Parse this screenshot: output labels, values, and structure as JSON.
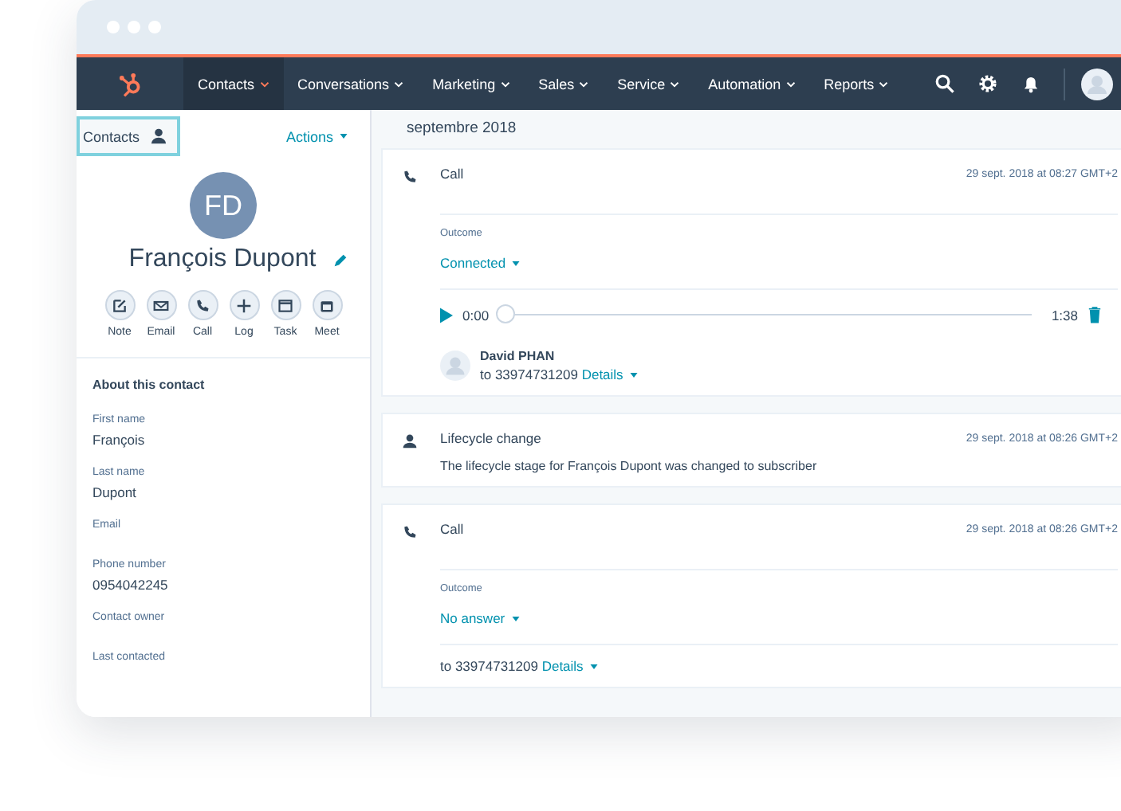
{
  "nav": {
    "items": [
      {
        "label": "Contacts",
        "selected": true
      },
      {
        "label": "Conversations",
        "selected": false
      },
      {
        "label": "Marketing",
        "selected": false
      },
      {
        "label": "Sales",
        "selected": false
      },
      {
        "label": "Service",
        "selected": false
      },
      {
        "label": "Automation",
        "selected": false
      },
      {
        "label": "Reports",
        "selected": false
      }
    ]
  },
  "sidebar": {
    "back_button": "Contacts",
    "actions": "Actions",
    "initials": "FD",
    "name": "François Dupont",
    "quick_actions": [
      {
        "kind": "note",
        "label": "Note"
      },
      {
        "kind": "email",
        "label": "Email"
      },
      {
        "kind": "call",
        "label": "Call"
      },
      {
        "kind": "log",
        "label": "Log"
      },
      {
        "kind": "task",
        "label": "Task"
      },
      {
        "kind": "meet",
        "label": "Meet"
      }
    ],
    "about_title": "About this contact",
    "fields": [
      {
        "label": "First name",
        "value": "François"
      },
      {
        "label": "Last name",
        "value": "Dupont"
      },
      {
        "label": "Email"
      },
      {
        "label": "Phone number",
        "value": "0954042245"
      },
      {
        "label": "Contact owner"
      },
      {
        "label": "Last contacted"
      }
    ]
  },
  "timeline": {
    "month": "septembre 2018",
    "events": [
      {
        "kind": "call",
        "title": "Call",
        "time": "29 sept. 2018 at 08:27 GMT+2",
        "outcome_label": "Outcome",
        "outcome": "Connected",
        "recording": {
          "start": "0:00",
          "end": "1:38",
          "level": 0
        },
        "contact": "David PHAN",
        "to": "to 33974731209",
        "details": "Details"
      },
      {
        "kind": "lifecycle",
        "title": "Lifecycle change",
        "time": "29 sept. 2018 at 08:26 GMT+2",
        "text": "The lifecycle stage for François Dupont was changed to subscriber"
      },
      {
        "kind": "call",
        "title": "Call",
        "time": "29 sept. 2018 at 08:26 GMT+2",
        "outcome_label": "Outcome",
        "outcome": "No answer",
        "to": "to 33974731209",
        "details": "Details"
      }
    ]
  }
}
